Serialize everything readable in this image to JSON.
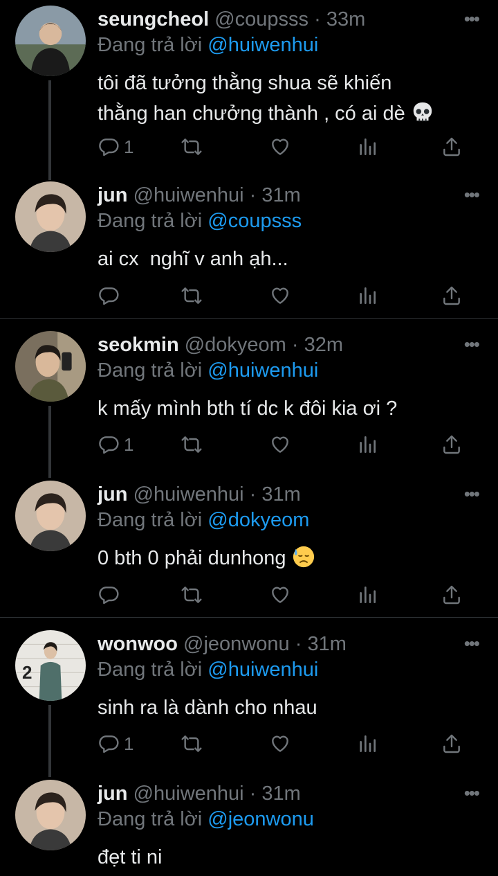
{
  "tweets": [
    {
      "name": "seungcheol",
      "handle": "@coupsss",
      "time": "33m",
      "replying_label": "Đang trả lời",
      "replying_to": "@huiwenhui",
      "text_lines": [
        "tôi đã tưởng thằng shua sẽ khiến",
        "thằng han chưởng thành , có ai dè"
      ],
      "emoji": "skull-emoji",
      "reply_count": "1"
    },
    {
      "name": "jun",
      "handle": "@huiwenhui",
      "time": "31m",
      "replying_label": "Đang trả lời",
      "replying_to": "@coupsss",
      "text_lines": [
        "ai cx  nghĩ v anh ạh..."
      ],
      "reply_count": ""
    },
    {
      "name": "seokmin",
      "handle": "@dokyeom",
      "time": "32m",
      "replying_label": "Đang trả lời",
      "replying_to": "@huiwenhui",
      "text_lines": [
        "k mấy mình bth tí dc k đôi kia ơi ?"
      ],
      "reply_count": "1"
    },
    {
      "name": "jun",
      "handle": "@huiwenhui",
      "time": "31m",
      "replying_label": "Đang trả lời",
      "replying_to": "@dokyeom",
      "text_lines": [
        "0 bth 0 phải dunhong"
      ],
      "emoji": "sweat-face-emoji",
      "reply_count": ""
    },
    {
      "name": "wonwoo",
      "handle": "@jeonwonu",
      "time": "31m",
      "replying_label": "Đang trả lời",
      "replying_to": "@huiwenhui",
      "text_lines": [
        "sinh ra là dành cho nhau"
      ],
      "reply_count": "1",
      "avatar_text": "2"
    },
    {
      "name": "jun",
      "handle": "@huiwenhui",
      "time": "31m",
      "replying_label": "Đang trả lời",
      "replying_to": "@jeonwonu",
      "text_lines": [
        "đẹt ti ni"
      ],
      "reply_count": ""
    }
  ],
  "ui": {
    "dot": "·",
    "more": "•••"
  },
  "colors": {
    "background": "#000000",
    "text": "#e7e9ea",
    "muted": "#71767b",
    "accent": "#1d9bf0",
    "divider": "#2f3336"
  }
}
